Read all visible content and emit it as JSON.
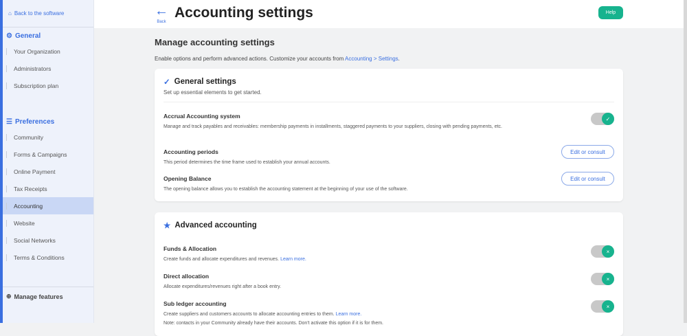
{
  "sidebar": {
    "back": "Back to the software",
    "general": {
      "label": "General",
      "items": [
        "Your Organization",
        "Administrators",
        "Subscription plan"
      ]
    },
    "preferences": {
      "label": "Preferences",
      "items": [
        "Community",
        "Forms & Campaigns",
        "Online Payment",
        "Tax Receipts",
        "Accounting",
        "Website",
        "Social Networks",
        "Terms & Conditions"
      ]
    },
    "manage": "Manage features",
    "active": "Accounting"
  },
  "header": {
    "back": "Back",
    "title": "Accounting settings",
    "help": "Help"
  },
  "main": {
    "heading": "Manage accounting settings",
    "intro": "Enable options and perform advanced actions. Customize your accounts from ",
    "intro_link": "Accounting > Settings",
    "intro_end": ".",
    "general": {
      "title": "General settings",
      "subtitle": "Set up essential elements to get started.",
      "rows": [
        {
          "title": "Accrual Accounting system",
          "desc": "Manage and track payables and receivables: membership payments in installments, staggered payments to your suppliers, closing with pending payments, etc.",
          "toggle": true
        },
        {
          "title": "Accounting periods",
          "desc": "This period determines the time frame used to establish your annual accounts.",
          "button": "Edit or consult"
        },
        {
          "title": "Opening Balance",
          "desc": "The opening balance allows you to establish the accounting statement at the beginning of your use of the software.",
          "button": "Edit or consult"
        }
      ]
    },
    "advanced": {
      "title": "Advanced accounting",
      "rows": [
        {
          "title": "Funds & Allocation",
          "desc": "Create funds and allocate expenditures and revenues. ",
          "link": "Learn more."
        },
        {
          "title": "Direct allocation",
          "desc": "Allocate expenditures/revenues right after a book entry."
        },
        {
          "title": "Sub ledger accounting",
          "desc": "Create suppliers and customers accounts to allocate accounting entries to them. ",
          "link": "Learn more.",
          "note": "Note: contacts in your Community already have their accounts. Don't activate this option if it is for them."
        }
      ]
    }
  },
  "colors": {
    "accent": "#3a6fe0",
    "toggle": "#17b38e"
  }
}
